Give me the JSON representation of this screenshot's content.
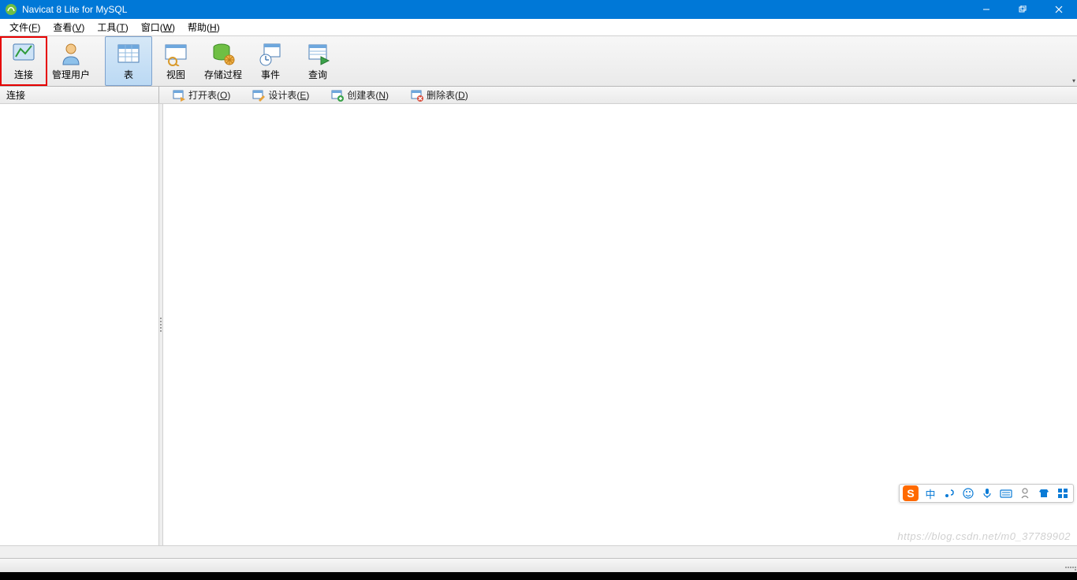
{
  "titlebar": {
    "title": "Navicat 8 Lite for MySQL"
  },
  "menubar": {
    "items": [
      {
        "pre": "文件(",
        "u": "F",
        "post": ")"
      },
      {
        "pre": "查看(",
        "u": "V",
        "post": ")"
      },
      {
        "pre": "工具(",
        "u": "T",
        "post": ")"
      },
      {
        "pre": "窗口(",
        "u": "W",
        "post": ")"
      },
      {
        "pre": "帮助(",
        "u": "H",
        "post": ")"
      }
    ]
  },
  "toolbar": {
    "connect": "连接",
    "users": "管理用户",
    "table": "表",
    "view": "视图",
    "storedproc": "存储过程",
    "event": "事件",
    "query": "查询"
  },
  "subbar": {
    "left_label": "连接",
    "open": {
      "pre": "打开表(",
      "u": "O",
      "post": ")"
    },
    "design": {
      "pre": "设计表(",
      "u": "E",
      "post": ")"
    },
    "create": {
      "pre": "创建表(",
      "u": "N",
      "post": ")"
    },
    "delete": {
      "pre": "删除表(",
      "u": "D",
      "post": ")"
    }
  },
  "ime": {
    "lang": "中"
  },
  "watermark": "https://blog.csdn.net/m0_37789902"
}
